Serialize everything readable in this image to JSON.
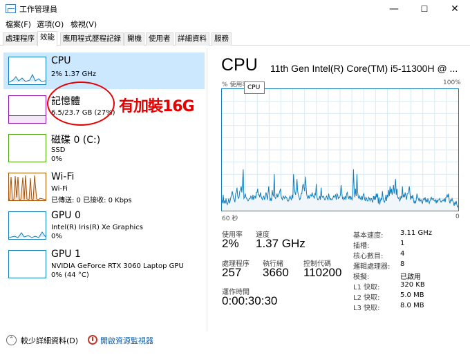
{
  "window": {
    "title": "工作管理員"
  },
  "menu": [
    "檔案(F)",
    "選項(O)",
    "檢視(V)"
  ],
  "tabs": [
    "處理程序",
    "效能",
    "應用程式歷程記錄",
    "開機",
    "使用者",
    "詳細資料",
    "服務"
  ],
  "resources": [
    {
      "name": "CPU",
      "line1": "2%  1.37 GHz",
      "color": "#117dbb"
    },
    {
      "name": "記憶體",
      "line1": "6.5/23.7 GB (27%)",
      "color": "#8b12ae"
    },
    {
      "name": "磁碟 0 (C:)",
      "line1": "SSD",
      "line2": "0%",
      "color": "#4da60c"
    },
    {
      "name": "Wi-Fi",
      "line1": "Wi-Fi",
      "line2": "已傳送: 0 已接收: 0 Kbps",
      "color": "#a74f01"
    },
    {
      "name": "GPU 0",
      "line1": "Intel(R) Iris(R) Xe Graphics",
      "line2": "0%",
      "color": "#117dbb"
    },
    {
      "name": "GPU 1",
      "line1": "NVIDIA GeForce RTX 3060 Laptop GPU",
      "line2": "0% (44 °C)",
      "color": "#117dbb"
    }
  ],
  "annotation": {
    "text": "有加裝16G"
  },
  "detail": {
    "title": "CPU",
    "processor": "11th Gen Intel(R) Core(TM) i5-11300H @ ...",
    "graph_label": "% 使用率",
    "graph_max": "100%",
    "graph_time": "60 秒",
    "graph_min": "0",
    "tooltip": "CPU",
    "cpu_history_percent": [
      9,
      6,
      13,
      6,
      8,
      6,
      10,
      6,
      5,
      7,
      10,
      6,
      8,
      11,
      13,
      16,
      13,
      10,
      9,
      7,
      14,
      15,
      19,
      12,
      10,
      11,
      16,
      17,
      20,
      15,
      24,
      34,
      10,
      11,
      14,
      11,
      10,
      9,
      8,
      9,
      10,
      10,
      12,
      11,
      9,
      13,
      9,
      11,
      12,
      10,
      15,
      15,
      18,
      13,
      13,
      11,
      15,
      12,
      10,
      9,
      11,
      12,
      9,
      11,
      15,
      13,
      9,
      14,
      20,
      12,
      8,
      10,
      8,
      17,
      13,
      12,
      30,
      11,
      10,
      12,
      14,
      11,
      13,
      14,
      16,
      18,
      12,
      10,
      9,
      12,
      11,
      10,
      12,
      11,
      11,
      8,
      8,
      8,
      11,
      12,
      10,
      9,
      13,
      10,
      30,
      21,
      15,
      13,
      19,
      26,
      16,
      13,
      11,
      9,
      10,
      14,
      14,
      20,
      22,
      19,
      16,
      28,
      22,
      14,
      11,
      10,
      12,
      10,
      13,
      13,
      12,
      15,
      12,
      12,
      10,
      14,
      13,
      22,
      11,
      9,
      9,
      10,
      12,
      9,
      19,
      12,
      11,
      12,
      11,
      9,
      9,
      11,
      12,
      10,
      9,
      14,
      11,
      9,
      10,
      9,
      9,
      10,
      12,
      11,
      12,
      13,
      9,
      14,
      13,
      10,
      11,
      11,
      13,
      21,
      15,
      10,
      11,
      9,
      10,
      12,
      9,
      14,
      15,
      11,
      10,
      12,
      9,
      12,
      10,
      9,
      13,
      34,
      18,
      11,
      18,
      12,
      30,
      16,
      11,
      10,
      12,
      10,
      9,
      12,
      9,
      13,
      14,
      10,
      8,
      11,
      10,
      8,
      8,
      11,
      10,
      8,
      10,
      10,
      8,
      7,
      12,
      9,
      12,
      9,
      14,
      11,
      14,
      6,
      11,
      5,
      8,
      10,
      9,
      16,
      10,
      8,
      7,
      9,
      13,
      8,
      13,
      11,
      17,
      12,
      20,
      14,
      18,
      13,
      16,
      21,
      14,
      19,
      26,
      13,
      18,
      11,
      10,
      11,
      8,
      9,
      12,
      10,
      20,
      11,
      13,
      11,
      15,
      12,
      9,
      14,
      14,
      16,
      20,
      14,
      9,
      12,
      10,
      13,
      9,
      6,
      8,
      6,
      9,
      14,
      11,
      10,
      8,
      10,
      8,
      9,
      7,
      6,
      9,
      10,
      9,
      11,
      7,
      9,
      7,
      10,
      8,
      6,
      8,
      10,
      11,
      9,
      10,
      10,
      8,
      8,
      9,
      6,
      9,
      7,
      9,
      9,
      10,
      8,
      7,
      8,
      8,
      9,
      8,
      10,
      7,
      11,
      11,
      13,
      11,
      14,
      8,
      6,
      9,
      8,
      10,
      8,
      7,
      4,
      7,
      5,
      8,
      5,
      3,
      4
    ],
    "stats": {
      "utilization_label": "使用率",
      "utilization": "2%",
      "speed_label": "速度",
      "speed": "1.37 GHz",
      "processes_label": "處理程序",
      "processes": "257",
      "threads_label": "執行緒",
      "threads": "3660",
      "handles_label": "控制代碼",
      "handles": "110200",
      "uptime_label": "運作時間",
      "uptime": "0:00:30:30"
    },
    "specs": [
      {
        "label": "基本速度:",
        "value": "3.11 GHz"
      },
      {
        "label": "插槽:",
        "value": "1"
      },
      {
        "label": "核心數目:",
        "value": "4"
      },
      {
        "label": "邏輯處理器:",
        "value": "8"
      },
      {
        "label": "模擬:",
        "value": "已啟用"
      },
      {
        "label": "L1 快取:",
        "value": "320 KB"
      },
      {
        "label": "L2 快取:",
        "value": "5.0 MB"
      },
      {
        "label": "L3 快取:",
        "value": "8.0 MB"
      }
    ]
  },
  "footer": {
    "fewer_details": "較少詳細資料(D)",
    "resource_monitor": "開啟資源監視器"
  }
}
